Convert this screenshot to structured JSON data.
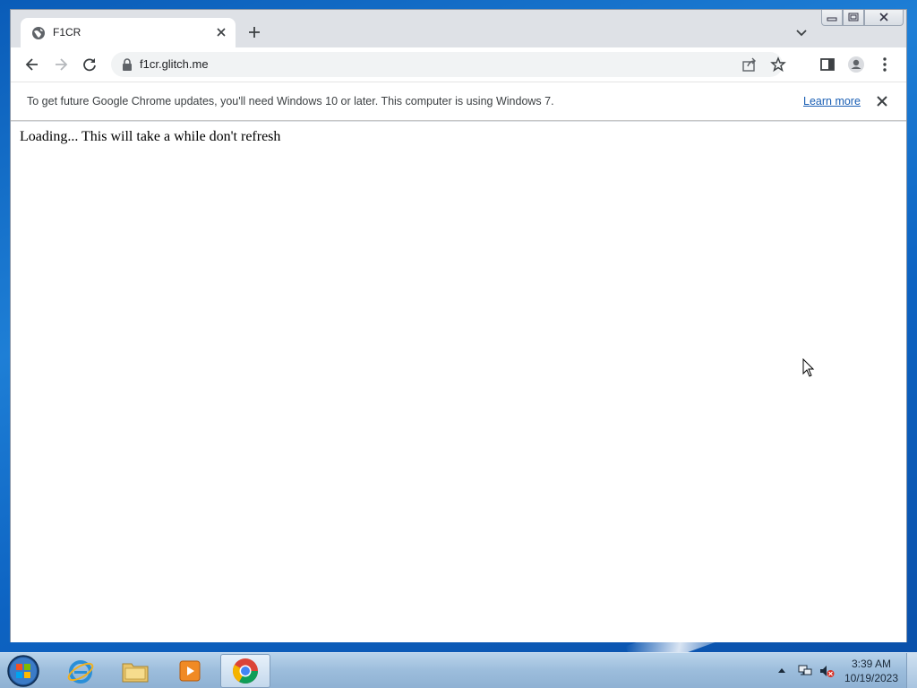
{
  "browser": {
    "tab": {
      "title": "F1CR"
    },
    "address_bar": {
      "url": "f1cr.glitch.me"
    }
  },
  "infobar": {
    "message": "To get future Google Chrome updates, you'll need Windows 10 or later. This computer is using Windows 7.",
    "link_label": "Learn more"
  },
  "page": {
    "text": "Loading... This will take a while don't refresh"
  },
  "taskbar": {
    "apps": [
      "start-orb",
      "internet-explorer",
      "file-explorer",
      "media-player",
      "google-chrome"
    ],
    "active_app": "google-chrome",
    "clock_time": "3:39 AM",
    "clock_date": "10/19/2023"
  },
  "colors": {
    "link": "#1a5fb4",
    "desktop": "#0d63c2",
    "taskbar": "#9cbddc"
  }
}
